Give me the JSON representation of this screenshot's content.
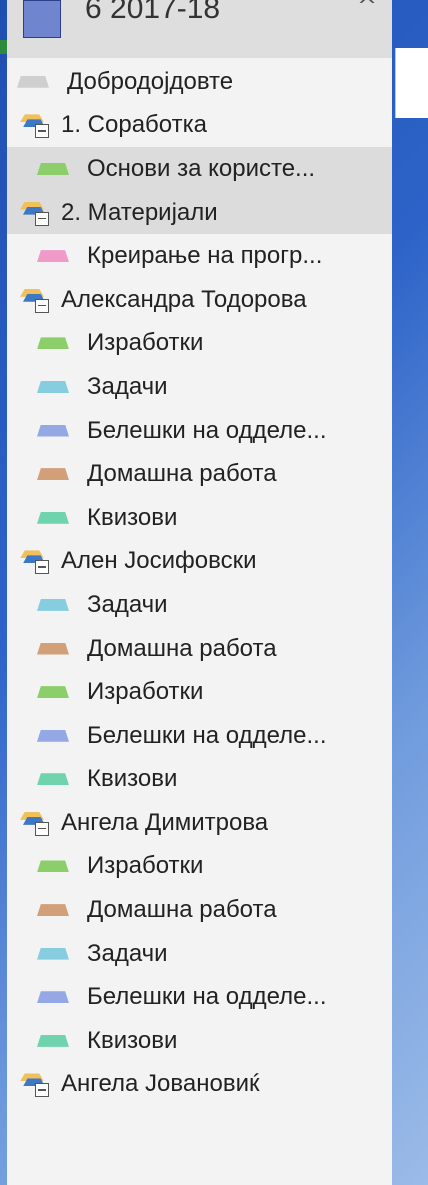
{
  "notebook": {
    "title": "6 2017-18",
    "chevron": "^"
  },
  "items": [
    {
      "type": "section",
      "level": 0,
      "label": "Добродојдовте",
      "color": "#cfcfcf"
    },
    {
      "type": "group",
      "level": 0,
      "label": "1. Соработка"
    },
    {
      "type": "section",
      "level": 1,
      "label": "Основи за користе...",
      "color": "#8ccf6a",
      "selected": true
    },
    {
      "type": "group",
      "level": 0,
      "label": "2. Материјали",
      "selected": true
    },
    {
      "type": "section",
      "level": 1,
      "label": "Креирање на прогр...",
      "color": "#f09ac8"
    },
    {
      "type": "group",
      "level": 0,
      "label": "Александра Тодорова"
    },
    {
      "type": "section",
      "level": 1,
      "label": "Изработки",
      "color": "#8ccf6a"
    },
    {
      "type": "section",
      "level": 1,
      "label": "Задачи",
      "color": "#86cde0"
    },
    {
      "type": "section",
      "level": 1,
      "label": "Белешки на одделе...",
      "color": "#93a8e4"
    },
    {
      "type": "section",
      "level": 1,
      "label": "Домашна работа",
      "color": "#d2a078"
    },
    {
      "type": "section",
      "level": 1,
      "label": "Квизови",
      "color": "#6fd3ae"
    },
    {
      "type": "group",
      "level": 0,
      "label": "Ален Јосифовски"
    },
    {
      "type": "section",
      "level": 1,
      "label": "Задачи",
      "color": "#86cde0"
    },
    {
      "type": "section",
      "level": 1,
      "label": "Домашна работа",
      "color": "#d2a078"
    },
    {
      "type": "section",
      "level": 1,
      "label": "Изработки",
      "color": "#8ccf6a"
    },
    {
      "type": "section",
      "level": 1,
      "label": "Белешки на одделе...",
      "color": "#93a8e4"
    },
    {
      "type": "section",
      "level": 1,
      "label": "Квизови",
      "color": "#6fd3ae"
    },
    {
      "type": "group",
      "level": 0,
      "label": "Ангела Димитрова"
    },
    {
      "type": "section",
      "level": 1,
      "label": "Изработки",
      "color": "#8ccf6a"
    },
    {
      "type": "section",
      "level": 1,
      "label": "Домашна работа",
      "color": "#d2a078"
    },
    {
      "type": "section",
      "level": 1,
      "label": "Задачи",
      "color": "#86cde0"
    },
    {
      "type": "section",
      "level": 1,
      "label": "Белешки на одделе...",
      "color": "#93a8e4"
    },
    {
      "type": "section",
      "level": 1,
      "label": "Квизови",
      "color": "#6fd3ae"
    },
    {
      "type": "group",
      "level": 0,
      "label": "Ангела Јовановиќ"
    }
  ]
}
